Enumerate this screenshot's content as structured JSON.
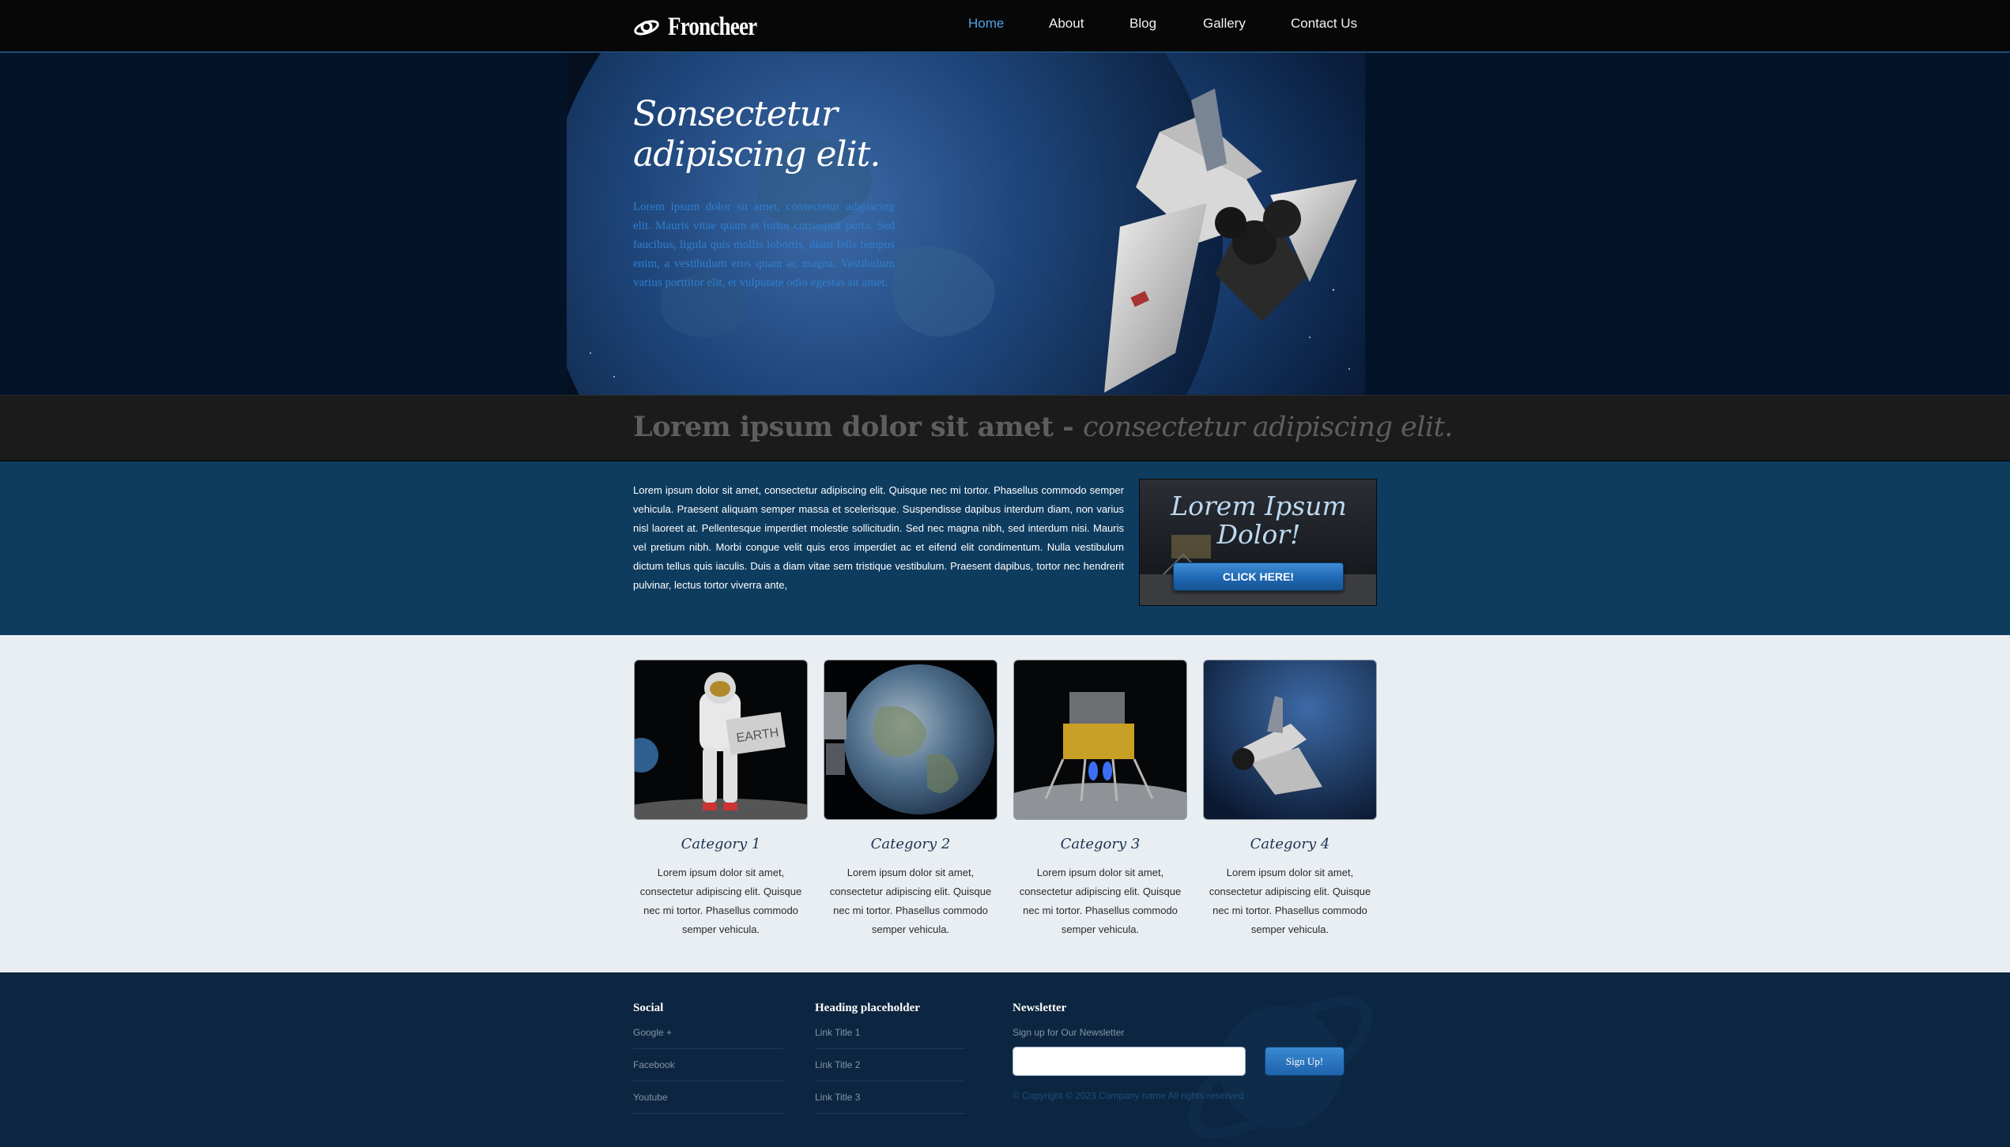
{
  "header": {
    "brand": "Froncheer",
    "nav": [
      "Home",
      "About",
      "Blog",
      "Gallery",
      "Contact Us"
    ],
    "active": "Home"
  },
  "hero": {
    "title_line1": "Sonsectetur",
    "title_line2": "adipiscing elit.",
    "text": "Lorem ipsum dolor sit amet, consectetur adipiscing elit. Mauris vitae quam et tortor consequat porta. Sed faucibus, ligula quis mollis lobortis, diam felis tempus enim, a vestibulum eros quam ac magna. Vestibulum varius porttitor elit, et vulputate odio egestas sit amet."
  },
  "tagline": {
    "strong": "Lorem ipsum dolor sit amet",
    "separator": " - ",
    "italic": "consectetur adipiscing elit."
  },
  "info": {
    "text": "Lorem ipsum dolor sit amet, consectetur adipiscing elit. Quisque nec mi tortor. Phasellus commodo semper vehicula. Praesent aliquam semper massa et scelerisque. Suspendisse dapibus interdum diam, non varius nisl laoreet at. Pellentesque imperdiet molestie sollicitudin. Sed nec magna nibh, sed interdum nisi. Mauris vel pretium nibh. Morbi congue velit quis eros imperdiet ac et eifend elit condimentum. Nulla vestibulum dictum tellus quis iaculis. Duis a diam vitae sem tristique vestibulum. Praesent dapibus, tortor nec hendrerit pulvinar, lectus tortor viverra ante,",
    "promo_title": "Lorem Ipsum Dolor!",
    "promo_button": "CLICK HERE!"
  },
  "categories": [
    {
      "title": "Category 1",
      "text": "Lorem ipsum dolor sit amet, consectetur adipiscing elit. Quisque nec mi tortor. Phasellus commodo semper vehicula.",
      "image": "astronaut-holding-earth-sign"
    },
    {
      "title": "Category 2",
      "text": "Lorem ipsum dolor sit amet, consectetur adipiscing elit. Quisque nec mi tortor. Phasellus commodo semper vehicula.",
      "image": "planet-earth-from-space"
    },
    {
      "title": "Category 3",
      "text": "Lorem ipsum dolor sit amet, consectetur adipiscing elit. Quisque nec mi tortor. Phasellus commodo semper vehicula.",
      "image": "lunar-lander"
    },
    {
      "title": "Category 4",
      "text": "Lorem ipsum dolor sit amet, consectetur adipiscing elit. Quisque nec mi tortor. Phasellus commodo semper vehicula.",
      "image": "space-shuttle-over-earth"
    }
  ],
  "footer": {
    "social": {
      "heading": "Social",
      "links": [
        "Google +",
        "Facebook",
        "Youtube"
      ]
    },
    "links": {
      "heading": "Heading placeholder",
      "links": [
        "Link Title 1",
        "Link Title 2",
        "Link Title 3"
      ]
    },
    "newsletter": {
      "heading": "Newsletter",
      "subtext": "Sign up for Our Newsletter",
      "input_value": "",
      "button": "Sign Up!",
      "copyright": "© Copyright © 2023 Company name All rights reserved"
    }
  },
  "colors": {
    "accent": "#4da3e6",
    "header_bg": "#070708",
    "hero_text": "#2f7fd0",
    "band_blue": "#0e3c5f",
    "footer_bg": "#0c2540",
    "page_bg": "#e9eef3"
  }
}
